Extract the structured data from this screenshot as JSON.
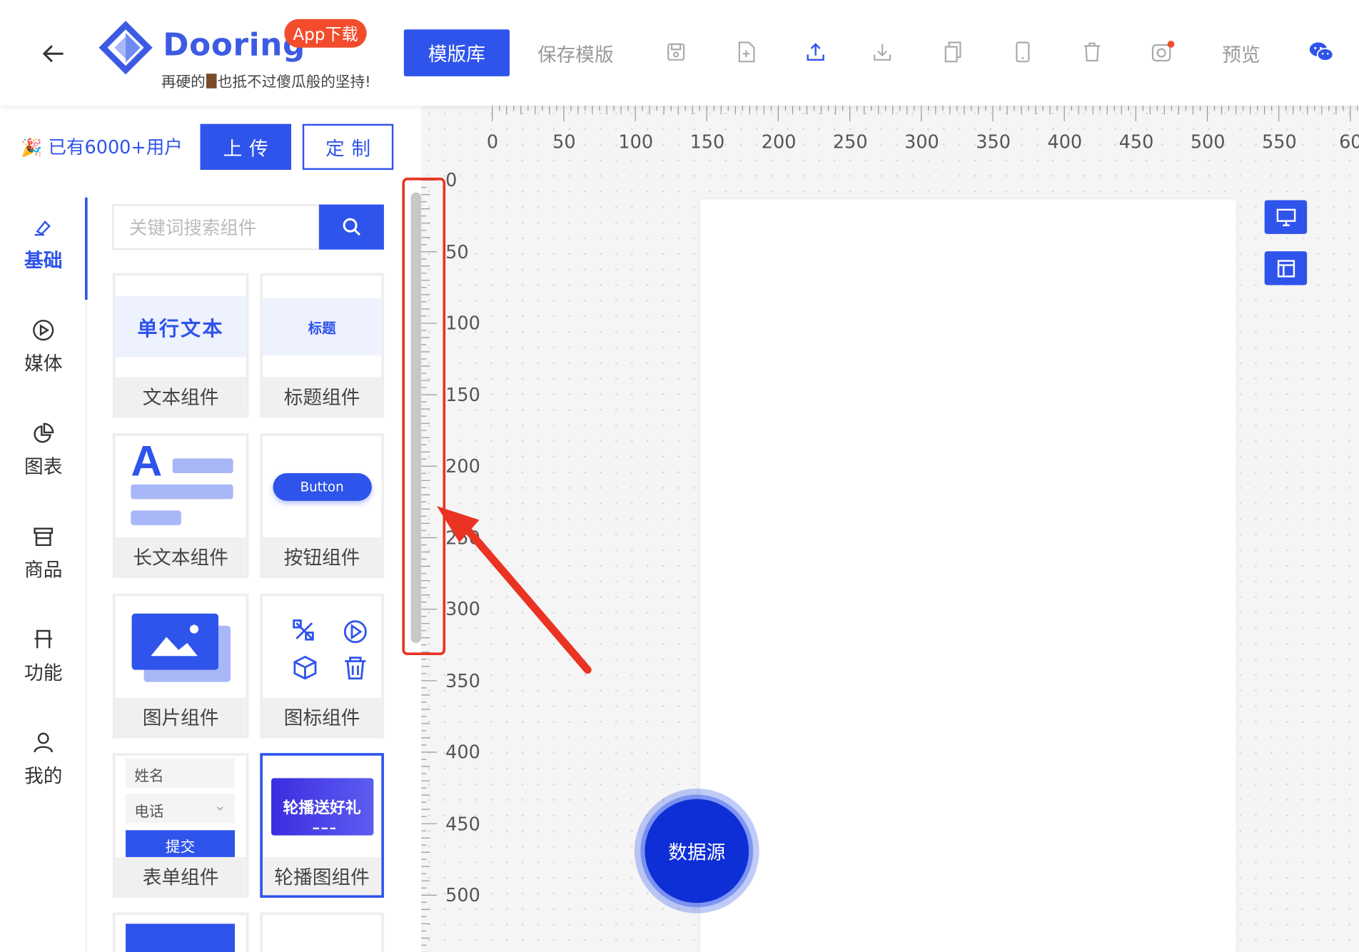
{
  "header": {
    "brand": "Dooring",
    "badge": "App下载",
    "slogan_before": "再硬的",
    "slogan_after": "也抵不过傻瓜般的坚持!",
    "template_lib": "模版库",
    "save_template": "保存模版",
    "preview": "预览",
    "tools": [
      "save-icon",
      "new-file-icon",
      "upload-icon",
      "download-icon",
      "copy-icon",
      "mobile-icon",
      "delete-icon",
      "camera-icon"
    ],
    "accent": "#2f54eb"
  },
  "sidebar": {
    "users": "已有6000+用户",
    "upload": "上传",
    "custom": "定制",
    "search_placeholder": "关键词搜索组件",
    "tabs": [
      {
        "label": "基础",
        "icon": "highlight-icon"
      },
      {
        "label": "媒体",
        "icon": "play-circle-icon"
      },
      {
        "label": "图表",
        "icon": "pie-chart-icon"
      },
      {
        "label": "商品",
        "icon": "shop-icon"
      },
      {
        "label": "功能",
        "icon": "function-icon"
      },
      {
        "label": "我的",
        "icon": "user-icon"
      }
    ],
    "components": [
      {
        "caption": "文本组件",
        "preview": "单行文本"
      },
      {
        "caption": "标题组件",
        "preview": "标题"
      },
      {
        "caption": "长文本组件",
        "preview": "A"
      },
      {
        "caption": "按钮组件",
        "preview": "Button"
      },
      {
        "caption": "图片组件"
      },
      {
        "caption": "图标组件"
      },
      {
        "caption": "表单组件",
        "fields": [
          "姓名",
          "电话"
        ],
        "submit": "提交"
      },
      {
        "caption": "轮播图组件",
        "preview": "轮播送好礼"
      }
    ]
  },
  "canvas": {
    "h_ticks": [
      "0",
      "50",
      "100",
      "150",
      "200",
      "250",
      "300",
      "350",
      "400",
      "450",
      "500",
      "550",
      "60"
    ],
    "v_ticks": [
      "0",
      "50",
      "100",
      "150",
      "200",
      "250",
      "300",
      "350",
      "400",
      "450",
      "500"
    ],
    "data_source": "数据源"
  }
}
